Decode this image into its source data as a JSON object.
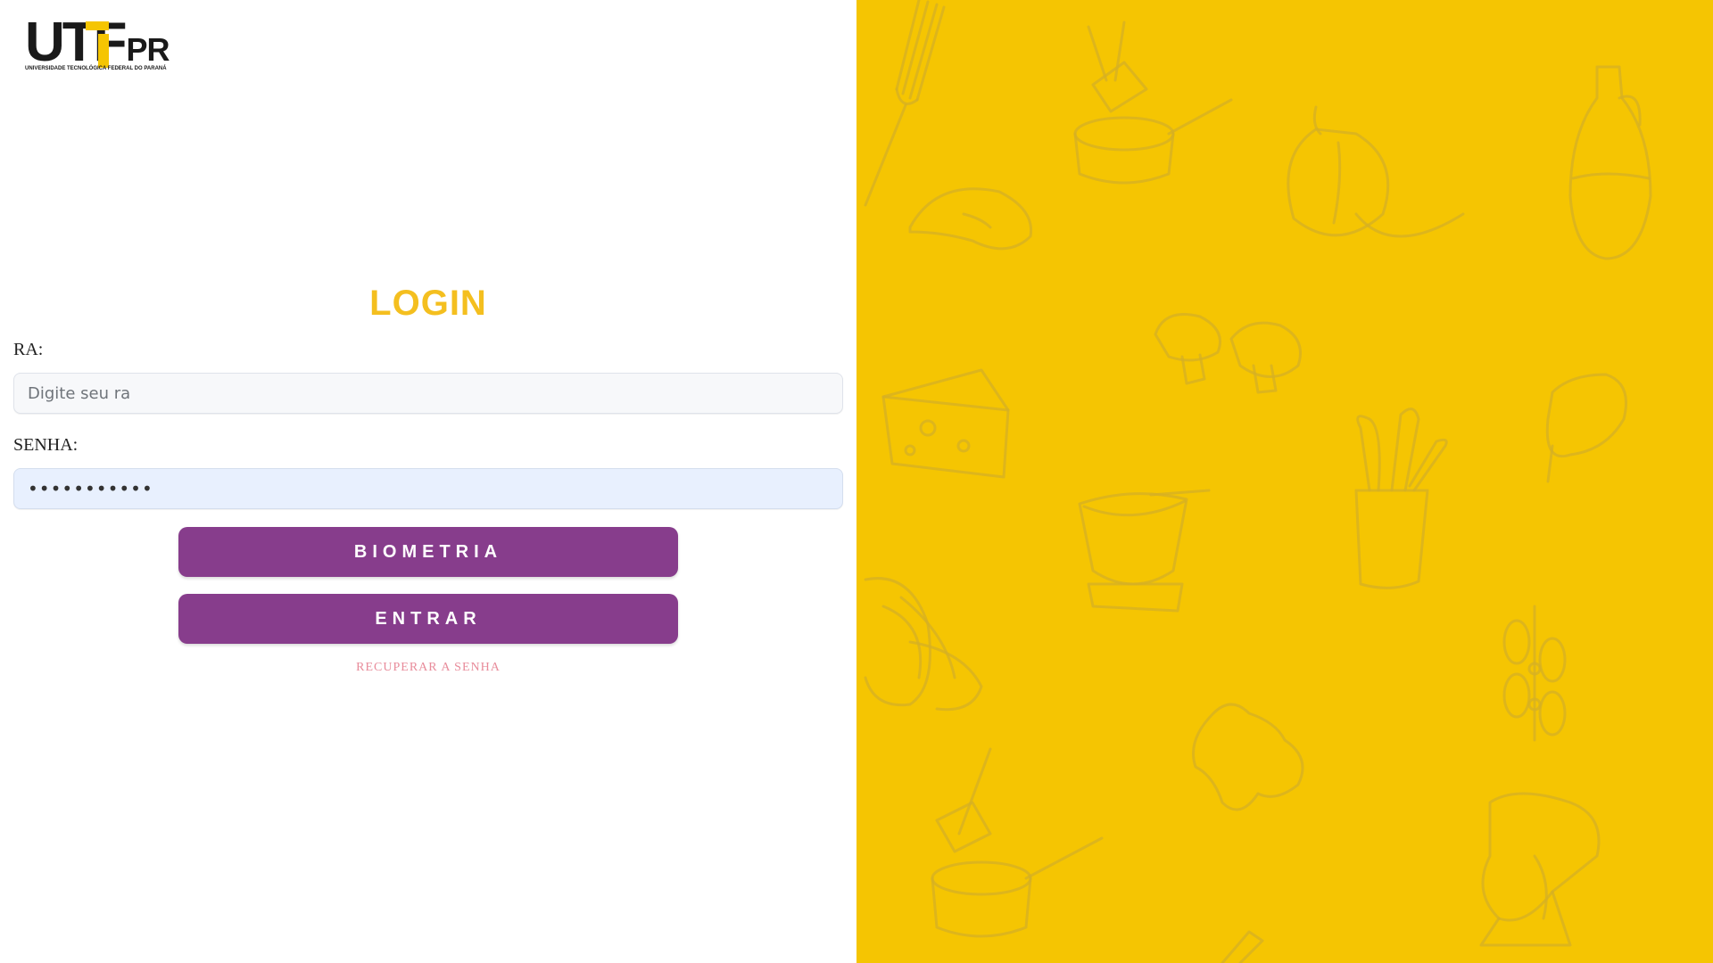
{
  "logo": {
    "wordmark": "UTF",
    "suffix": "PR",
    "subtitle": "UNIVERSIDADE TECNOLÓGICA FEDERAL DO PARANÁ"
  },
  "login": {
    "title": "LOGIN",
    "ra_label": "RA:",
    "ra_placeholder": "Digite seu ra",
    "senha_label": "SENHA:",
    "senha_value": "•••••••••••",
    "biometria_label": "BIOMETRIA",
    "entrar_label": "ENTRAR",
    "recover_label": "RECUPERAR A SENHA"
  },
  "colors": {
    "accent_yellow": "#f5c502",
    "title_yellow": "#f4bf1f",
    "button_purple": "#873d8c",
    "link_pink": "#e88b9a"
  },
  "decorations": {
    "pattern": "hand-drawn kitchen and food doodles",
    "icons": [
      "fork-icon",
      "pots-icon",
      "garlic-icon",
      "oil-bottle-icon",
      "meat-icon",
      "mushroom-icon",
      "cheese-icon",
      "utensils-icon",
      "mortar-icon",
      "pasta-icon",
      "olive-branch-icon",
      "ginger-icon",
      "mixer-icon"
    ]
  }
}
